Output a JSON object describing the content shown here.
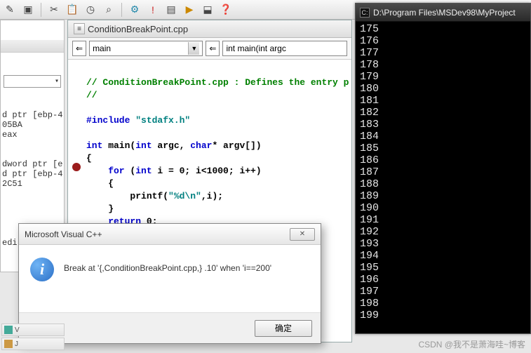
{
  "toolbar": {
    "icons": [
      "wand-icon",
      "folder-icon",
      "paste-icon",
      "clock-icon",
      "find-icon",
      "tools-icon",
      "error-icon",
      "doc-icon",
      "run-icon",
      "debug-icon",
      "help-icon"
    ]
  },
  "left_panel": {
    "lines": "d ptr [ebp-4\n05BA\neax\n\n\ndword ptr [e\nd ptr [ebp-4\n2C51\n\n\n\n\n\nedi"
  },
  "editor": {
    "filename": "ConditionBreakPoint.cpp",
    "scope_dropdown": "main",
    "func_dropdown": "int main(int argc",
    "code": {
      "l1_cmt": "// ConditionBreakPoint.cpp : Defines the entry p",
      "l2_cmt": "//",
      "l3_inc": "#include ",
      "l3_str": "\"stdafx.h\"",
      "l4_a": "int",
      "l4_b": " main(",
      "l4_c": "int",
      "l4_d": " argc, ",
      "l4_e": "char",
      "l4_f": "* argv[])",
      "l5": "{",
      "l6_a": "    for",
      "l6_b": " (",
      "l6_c": "int",
      "l6_d": " i = 0; i<1000; i++)",
      "l7": "    {",
      "l8_a": "        printf(",
      "l8_b": "\"%d\\n\"",
      "l8_c": ",i);",
      "l9": "    }",
      "l10_a": "    return",
      "l10_b": " 0;",
      "l11": "}"
    }
  },
  "console": {
    "title": "D:\\Program Files\\MSDev98\\MyProject",
    "lines": "175\n176\n177\n178\n179\n180\n181\n182\n183\n184\n185\n186\n187\n188\n189\n190\n191\n192\n193\n194\n195\n196\n197\n198\n199\n"
  },
  "dialog": {
    "title": "Microsoft Visual C++",
    "message": "Break at '{,ConditionBreakPoint.cpp,} .10'  when 'i==200'",
    "ok_label": "确定",
    "close_label": "✕"
  },
  "watermark": "CSDN @我不是萧海哇~博客",
  "bottom": {
    "tab1": "V",
    "tab2": "J"
  }
}
